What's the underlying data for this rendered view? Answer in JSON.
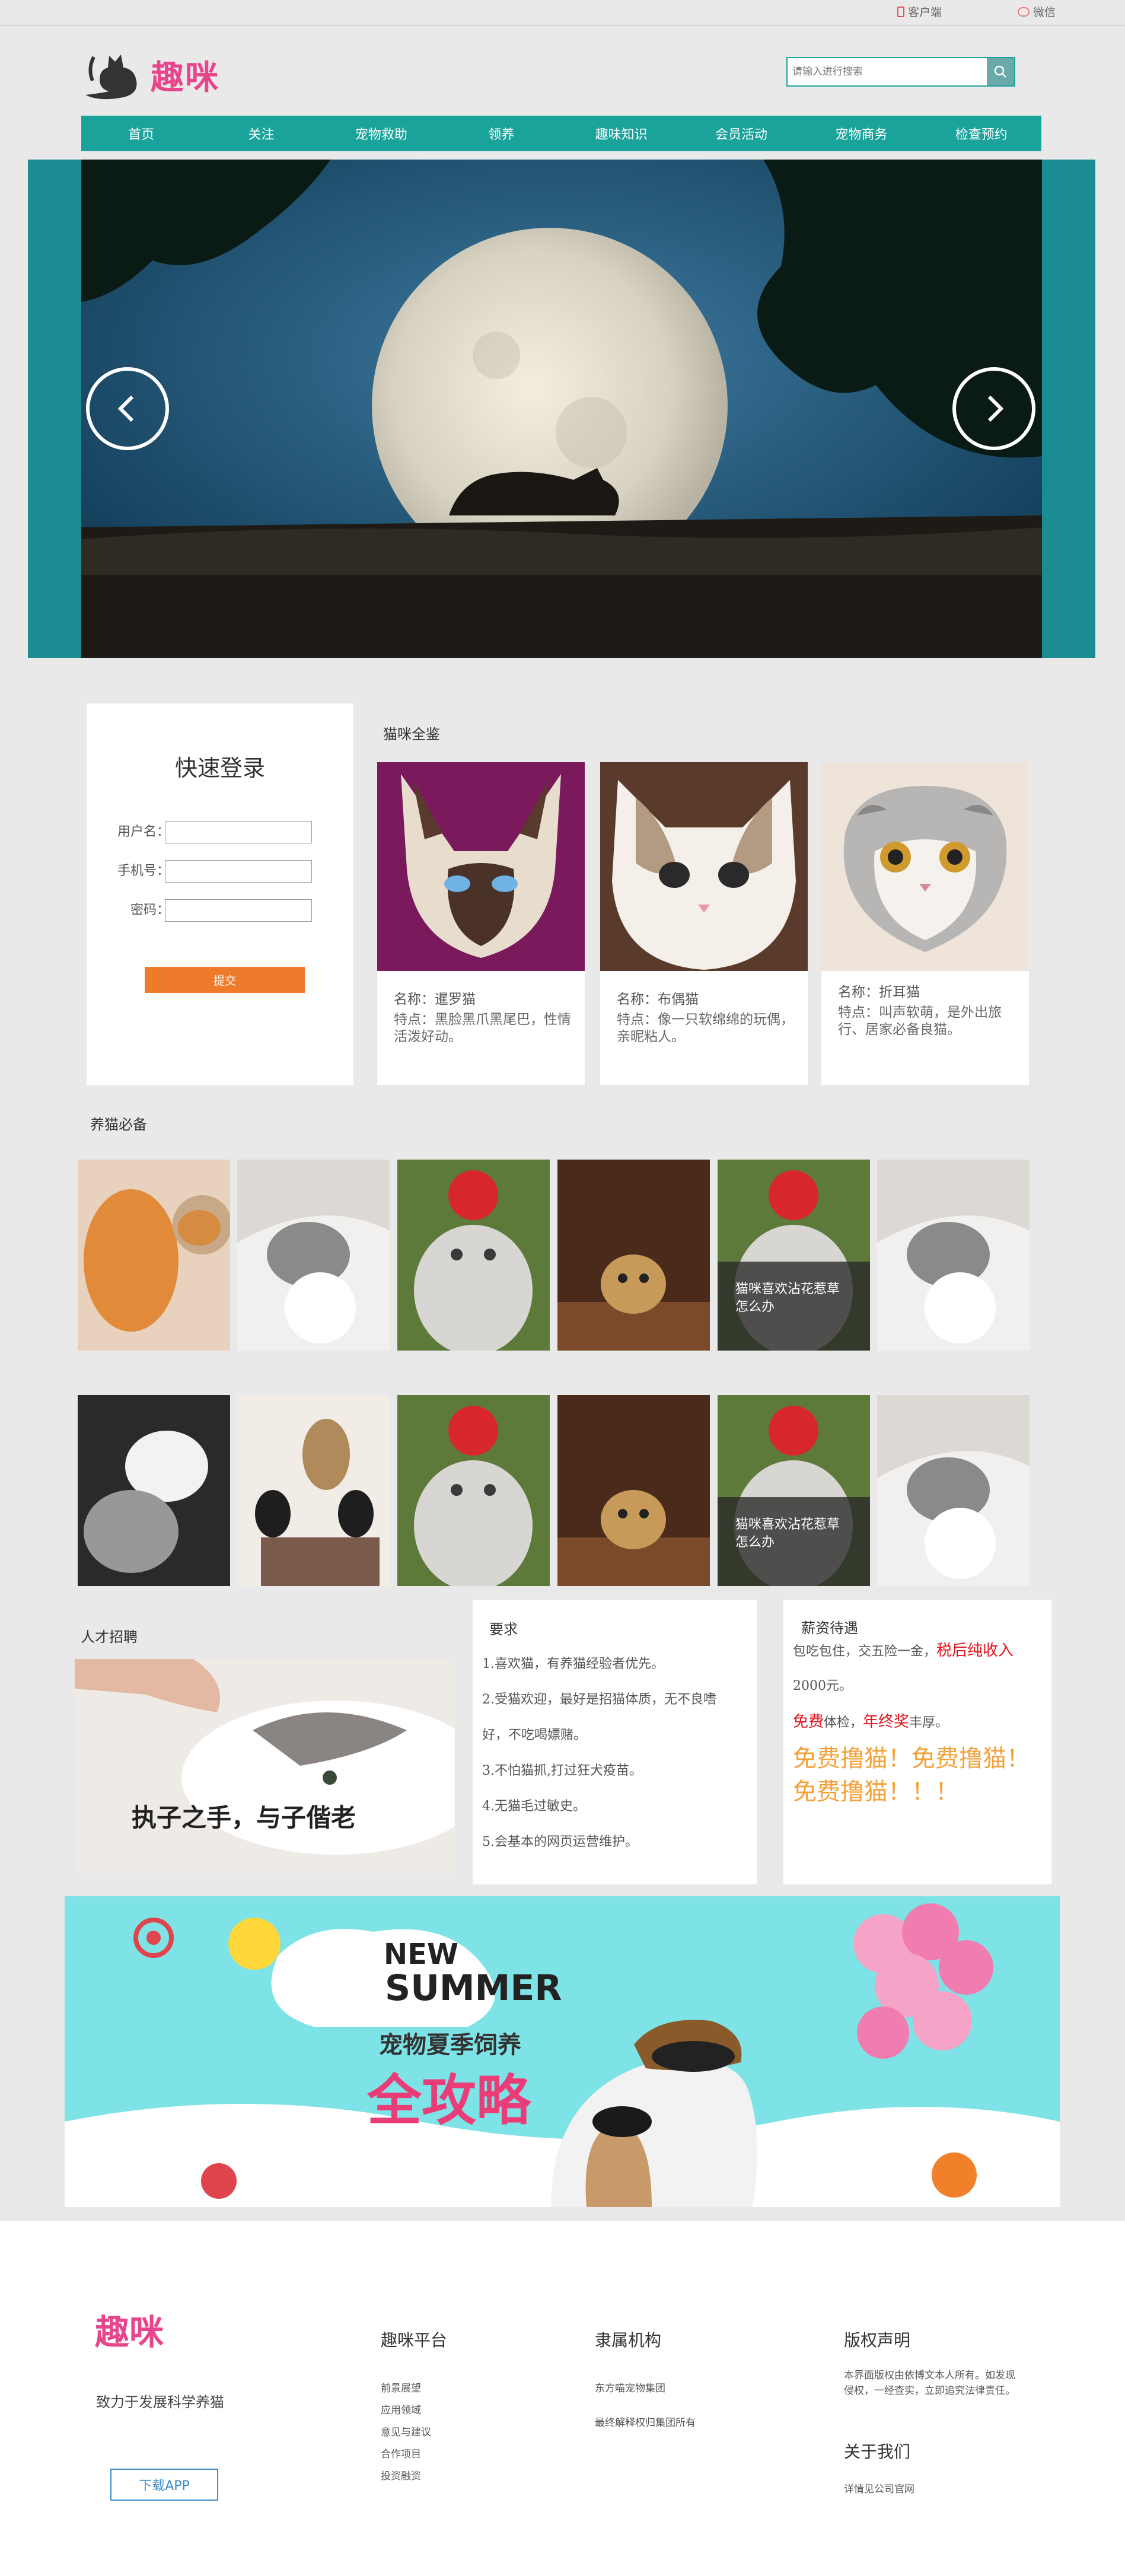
{
  "topbar": {
    "client": "客户端",
    "wechat": "微信"
  },
  "header": {
    "brand": "趣咪",
    "search_placeholder": "请输入进行搜索"
  },
  "nav": [
    "首页",
    "关注",
    "宠物救助",
    "领养",
    "趣味知识",
    "会员活动",
    "宠物商务",
    "检查预约"
  ],
  "login": {
    "title": "快速登录",
    "username_label": "用户名：",
    "phone_label": "手机号：",
    "password_label": "密码：",
    "submit": "提交"
  },
  "cats_section": {
    "title": "猫咪全鉴",
    "cards": [
      {
        "name": "名称：暹罗猫",
        "feature": "特点：黑脸黑爪黑尾巴，性情活泼好动。"
      },
      {
        "name": "名称：布偶猫",
        "feature": "特点：像一只软绵绵的玩偶，亲昵粘人。"
      },
      {
        "name": "名称：折耳猫",
        "feature": "特点：叫声软萌，是外出旅行、居家必备良猫。"
      }
    ]
  },
  "care_section": {
    "title": "养猫必备",
    "caption": "猫咪喜欢沾花惹草怎么办"
  },
  "recruit": {
    "title": "人才招聘",
    "image_text": "执子之手，与子偕老",
    "requirements_title": "要求",
    "requirements": [
      "1.喜欢猫，有养猫经验者优先。",
      "2.受猫欢迎，最好是招猫体质，无不良嗜",
      "好，不吃喝嫖赌。",
      "3.不怕猫抓,打过狂犬疫苗。",
      "4.无猫毛过敏史。",
      "5.会基本的网页运营维护。"
    ],
    "salary_title": "薪资待遇",
    "salary_line1": "包吃包住，交五险一金，",
    "salary_highlight1": "税后纯收入",
    "salary_line2": "2000元。",
    "salary_free": "免费",
    "salary_line3": "体检，",
    "salary_bonus": "年终奖",
    "salary_line4": "丰厚。",
    "salary_big": "免费撸猫！免费撸猫！免费撸猫！！！"
  },
  "summer_banner": {
    "new": "NEW",
    "summer": "SUMMER",
    "subtitle": "宠物夏季饲养",
    "headline": "全攻略"
  },
  "footer": {
    "brand": "趣咪",
    "slogan": "致力于发展科学养猫",
    "download": "下载APP",
    "platform_title": "趣咪平台",
    "platform_links": [
      "前景展望",
      "应用领域",
      "意见与建议",
      "合作项目",
      "投资融资"
    ],
    "org_title": "隶属机构",
    "org_links": [
      "东方喵宠物集团",
      "最终解释权归集团所有"
    ],
    "copyright_title": "版权声明",
    "copyright_text": "本界面版权由依博文本人所有。如发现侵权，一经查实，立即追究法律责任。",
    "about_title": "关于我们",
    "about_link": "详情见公司官网"
  },
  "colors": {
    "accent": "#1aa39b",
    "brand": "#e7458c",
    "button": "#ee7b2b",
    "red": "#e0141e",
    "gold": "#f4a13a"
  }
}
